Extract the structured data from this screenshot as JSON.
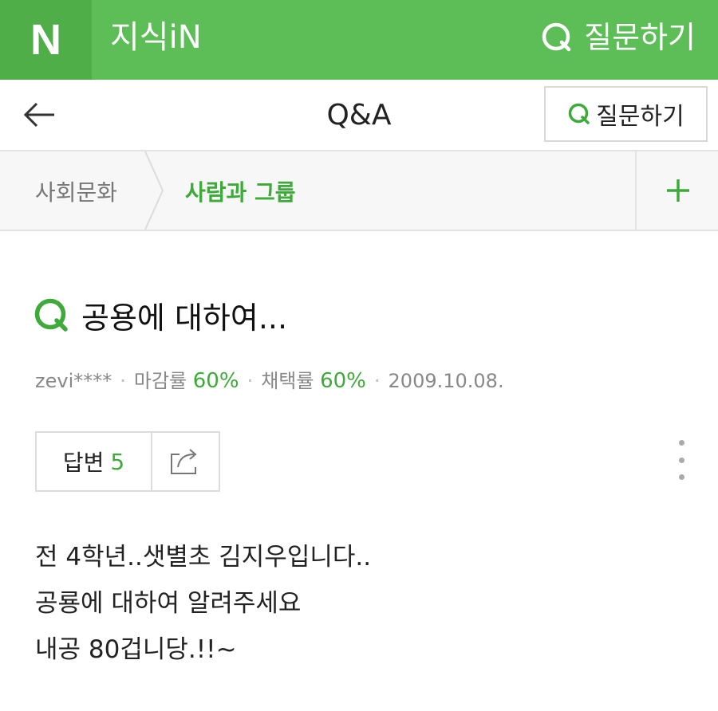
{
  "topbar": {
    "logo": "N",
    "brand": "지식iN",
    "ask_label": "질문하기"
  },
  "subheader": {
    "title": "Q&A",
    "ask_button_label": "질문하기"
  },
  "breadcrumb": {
    "items": [
      "사회문화",
      "사람과 그룹"
    ]
  },
  "question": {
    "title": "공용에 대하여...",
    "author": "zevi****",
    "close_rate_label": "마감률",
    "close_rate": "60%",
    "adopt_rate_label": "채택률",
    "adopt_rate": "60%",
    "date": "2009.10.08.",
    "answers_label": "답변",
    "answers_count": "5",
    "body": [
      "전 4학년..샛별초 김지우입니다..",
      "공룡에 대하여 알려주세요",
      "내공 80겁니당.!!~"
    ]
  },
  "colors": {
    "brand_green": "#5dbe57",
    "accent_green": "#3daa3a"
  },
  "icons": {
    "search": "q-search-icon",
    "back": "back-arrow-icon",
    "share": "share-icon",
    "add": "plus-icon",
    "more": "more-vertical-icon"
  }
}
